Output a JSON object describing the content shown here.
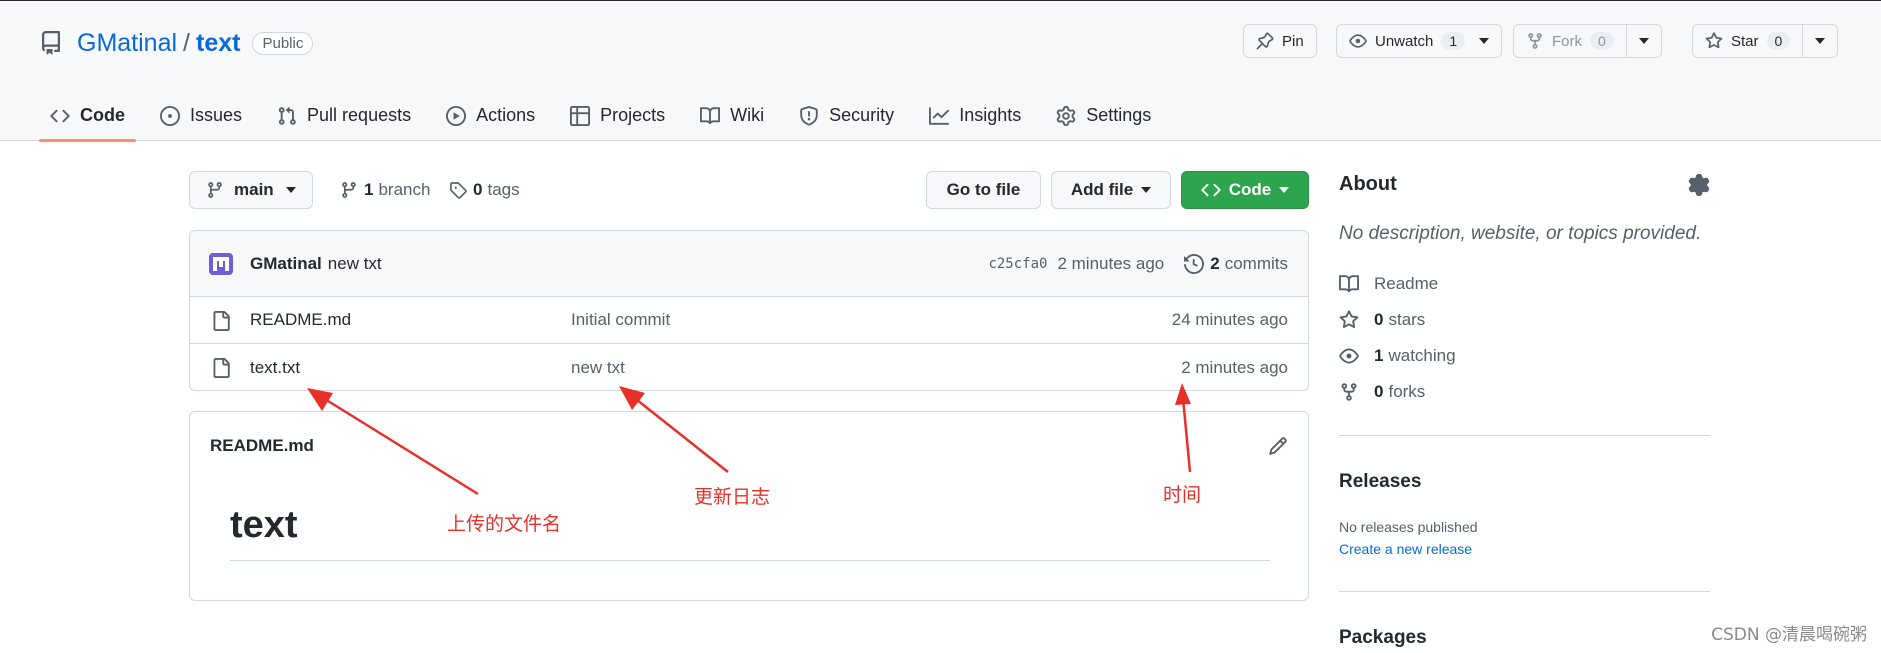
{
  "repo": {
    "owner": "GMatinal",
    "separator": "/",
    "name": "text",
    "visibility": "Public"
  },
  "header_actions": {
    "pin": {
      "label": "Pin"
    },
    "watch": {
      "label": "Unwatch",
      "count": "1"
    },
    "fork": {
      "label": "Fork",
      "count": "0"
    },
    "star": {
      "label": "Star",
      "count": "0"
    }
  },
  "tabs": [
    {
      "label": "Code",
      "icon": "code-icon",
      "active": true
    },
    {
      "label": "Issues",
      "icon": "issue-icon"
    },
    {
      "label": "Pull requests",
      "icon": "pull-request-icon"
    },
    {
      "label": "Actions",
      "icon": "play-icon"
    },
    {
      "label": "Projects",
      "icon": "table-icon"
    },
    {
      "label": "Wiki",
      "icon": "book-icon"
    },
    {
      "label": "Security",
      "icon": "shield-icon"
    },
    {
      "label": "Insights",
      "icon": "graph-icon"
    },
    {
      "label": "Settings",
      "icon": "gear-icon"
    }
  ],
  "toolbar": {
    "branch": "main",
    "branches_count": "1",
    "branches_label": "branch",
    "tags_count": "0",
    "tags_label": "tags",
    "go_to_file": "Go to file",
    "add_file": "Add file",
    "code": "Code"
  },
  "latest_commit": {
    "author": "GMatinal",
    "message": "new txt",
    "sha": "c25cfa0",
    "age": "2 minutes ago",
    "commits_count": "2",
    "commits_label": "commits"
  },
  "files": [
    {
      "name": "README.md",
      "commit": "Initial commit",
      "age": "24 minutes ago"
    },
    {
      "name": "text.txt",
      "commit": "new txt",
      "age": "2 minutes ago"
    }
  ],
  "readme": {
    "filename": "README.md",
    "heading": "text"
  },
  "sidebar": {
    "about_title": "About",
    "description": "No description, website, or topics provided.",
    "readme_label": "Readme",
    "stars_count": "0",
    "stars_label": "stars",
    "watching_count": "1",
    "watching_label": "watching",
    "forks_count": "0",
    "forks_label": "forks",
    "releases_title": "Releases",
    "releases_none": "No releases published",
    "create_release": "Create a new release",
    "packages_title": "Packages"
  },
  "annotations": {
    "filename_note": "上传的文件名",
    "log_note": "更新日志",
    "time_note": "时间",
    "color": "#e8302a"
  },
  "watermark": "CSDN @清晨喝碗粥",
  "colors": {
    "link": "#0969da",
    "tab_underline": "#fd8c73",
    "code_button": "#2da44e",
    "border": "#d0d7de"
  }
}
